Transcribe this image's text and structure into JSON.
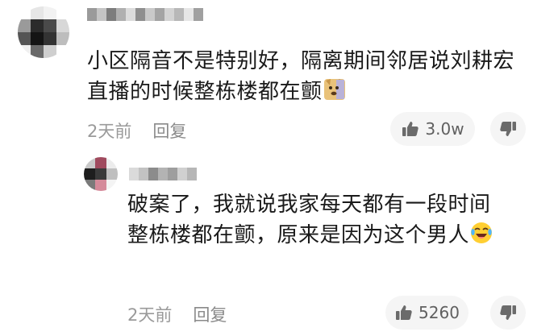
{
  "thread": {
    "main_comment": {
      "avatar_icon": "pixelated-avatar-icon",
      "username_icon": "blurred-username-icon",
      "text": "小区隔音不是特别好，隔离期间邻居说刘耕宏直播的时候整栋楼都在颤",
      "emoji_icon": "doge-emoji-icon",
      "time": "2天前",
      "reply_label": "回复",
      "likes": "3.0w",
      "like_icon": "thumbs-up-icon",
      "dislike_icon": "thumbs-down-icon"
    },
    "reply_comment": {
      "avatar_icon": "pixelated-avatar-icon",
      "username_icon": "blurred-username-icon",
      "text": "破案了，我就说我家每天都有一段时间整栋楼都在颤，原来是因为这个男人",
      "emoji_icon": "laughing-emoji-icon",
      "time": "2天前",
      "reply_label": "回复",
      "likes": "5260",
      "like_icon": "thumbs-up-icon",
      "dislike_icon": "thumbs-down-icon"
    }
  },
  "colors": {
    "text": "#1a1a1a",
    "meta": "#9a9a9a",
    "pill_bg": "#f5f5f5",
    "icon": "#606060",
    "background": "#ffffff"
  }
}
